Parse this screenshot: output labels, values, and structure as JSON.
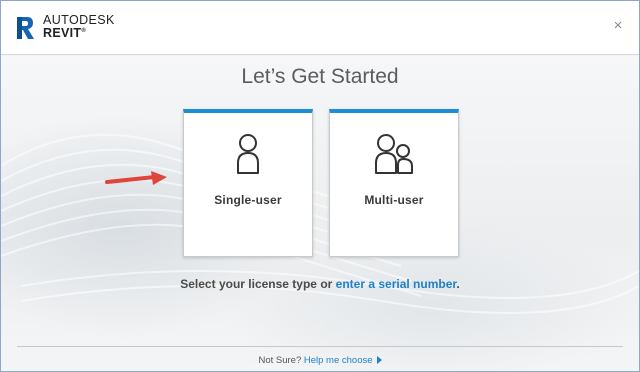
{
  "header": {
    "brand_line1": "AUTODESK",
    "brand_line2": "REVIT",
    "logo_letter": "R",
    "close_symbol": "×"
  },
  "main": {
    "heading": "Let’s Get Started",
    "cards": [
      {
        "label": "Single-user",
        "icon": "single-person-icon"
      },
      {
        "label": "Multi-user",
        "icon": "multi-person-icon"
      }
    ],
    "license_prompt": "Select your license type or",
    "serial_link": "enter a serial number",
    "serial_suffix": "."
  },
  "footer": {
    "question": "Not Sure?",
    "help_link": "Help me choose"
  },
  "colors": {
    "accent": "#1f8dd6",
    "link": "#1f7fc9",
    "arrow": "#e0453a"
  }
}
